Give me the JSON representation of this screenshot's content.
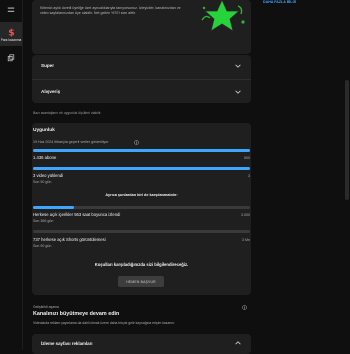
{
  "rail": {
    "items": [
      {
        "icon": "dollar-icon",
        "label": "Para kazanma",
        "active": true,
        "color": "#ff4e45"
      },
      {
        "icon": "copy-icon",
        "label": ""
      }
    ]
  },
  "side": {
    "link": "DAHA FAZLA BİLGİ"
  },
  "promo": {
    "text": "Kitlenizi aylık ücretli üyeliğe özel ayrıcalıklarıyla tanıyorsunuz. İzleyiciler, kanalınızdan ve video sayfalarınızdan üye olabilir. Net gelirin %70'i size aittir."
  },
  "accordions": [
    {
      "label": "Super"
    },
    {
      "label": "Alışveriş"
    }
  ],
  "note": "Bazı avantajların ek uygunluk ölçütleri olabilir.",
  "eligibility": {
    "title": "Uygunluk",
    "updated": "19 Haz 2024 itibarıyla geçerli veriler gösteriliyor",
    "subscribers": {
      "label": "1.436 abone",
      "target": "500",
      "progress": 1.0
    },
    "uploads": {
      "label": "3 video yüklendi",
      "sub": "Son 90 gün",
      "target": "3",
      "progress": 1.0
    },
    "choose_label": "Ayrıca şunlardan biri de karşılanmalıdır:",
    "watch_hours": {
      "label": "Herkese açık içerikler 563 saat boyunca izlendi",
      "sub": "Son 365 gün",
      "target": "3.000",
      "progress": 0.19
    },
    "shorts_views": {
      "label": "737 herkese açık Shorts görüntülemesi",
      "sub": "Son 90 gün",
      "target": "3 Mn",
      "progress": 0.0002
    },
    "notify_text": "Koşulları karşıladığınızda sizi bilgilendireceğiz.",
    "apply_button": "HEMEN BAŞVUR"
  },
  "growth": {
    "eyebrow": "Geliştirildi aşama",
    "title": "Kanalınızı büyütmeye devam edin",
    "desc": "Videolarda reklam yayınlama da dahil olmak üzere daha birçok gelir kaynağına erişim kazanın."
  },
  "bottom_card": {
    "label": "İzleme sayfası reklamları"
  }
}
